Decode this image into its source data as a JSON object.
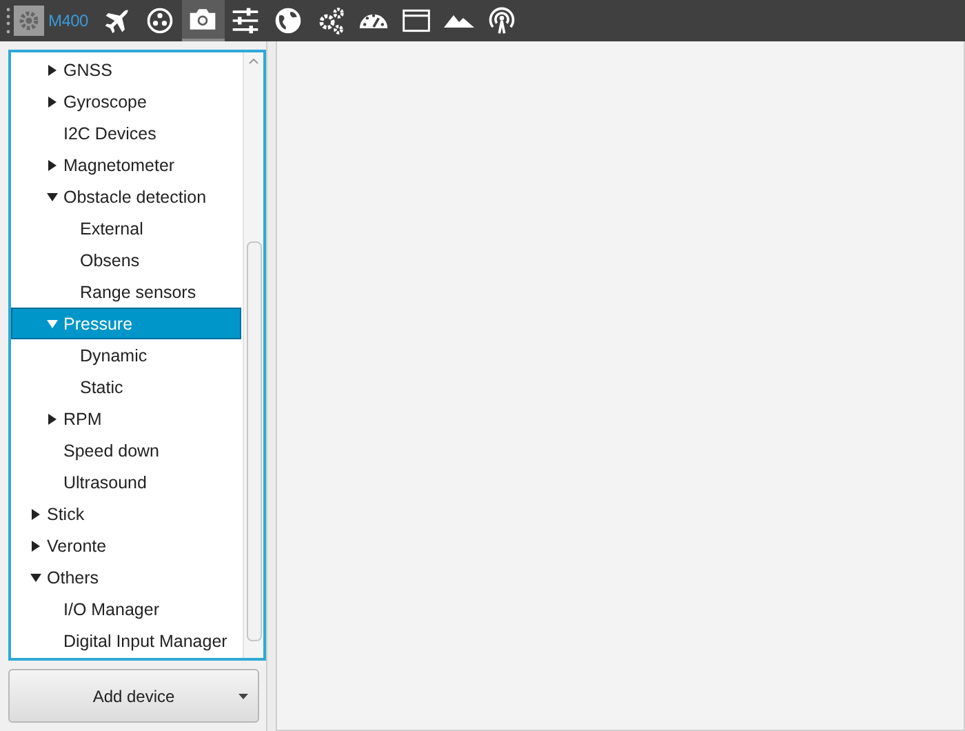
{
  "toolbar": {
    "device_label": "M400",
    "tools": [
      {
        "kind": "plane",
        "selected": false
      },
      {
        "kind": "dots",
        "selected": false
      },
      {
        "kind": "camera",
        "selected": true
      },
      {
        "kind": "sliders",
        "selected": false
      },
      {
        "kind": "globe",
        "selected": false
      },
      {
        "kind": "gears",
        "selected": false
      },
      {
        "kind": "gauge",
        "selected": false
      },
      {
        "kind": "window",
        "selected": false
      },
      {
        "kind": "mountains",
        "selected": false
      },
      {
        "kind": "antenna",
        "selected": false
      }
    ]
  },
  "tree": {
    "hidden_parent_children": [
      {
        "label": "GNSS",
        "expanded": false,
        "selected": false
      },
      {
        "label": "Gyroscope",
        "expanded": false,
        "selected": false
      },
      {
        "label": "I2C Devices",
        "selected": false
      },
      {
        "label": "Magnetometer",
        "expanded": false,
        "selected": false
      },
      {
        "label": "Obstacle detection",
        "expanded": true,
        "selected": false,
        "children": [
          {
            "label": "External",
            "selected": false
          },
          {
            "label": "Obsens",
            "selected": false
          },
          {
            "label": "Range sensors",
            "selected": false
          }
        ]
      },
      {
        "label": "Pressure",
        "expanded": true,
        "selected": true,
        "children": [
          {
            "label": "Dynamic",
            "selected": false
          },
          {
            "label": "Static",
            "selected": false
          }
        ]
      },
      {
        "label": "RPM",
        "expanded": false,
        "selected": false
      },
      {
        "label": "Speed down",
        "selected": false
      },
      {
        "label": "Ultrasound",
        "selected": false
      }
    ],
    "items": [
      {
        "label": "Stick",
        "expanded": false,
        "selected": false
      },
      {
        "label": "Veronte",
        "expanded": false,
        "selected": false
      },
      {
        "label": "Others",
        "expanded": true,
        "selected": false,
        "children": [
          {
            "label": "I/O Manager",
            "selected": false
          },
          {
            "label": "Digital Input Manager",
            "selected": false
          }
        ]
      }
    ]
  },
  "add_button": {
    "label": "Add device"
  }
}
